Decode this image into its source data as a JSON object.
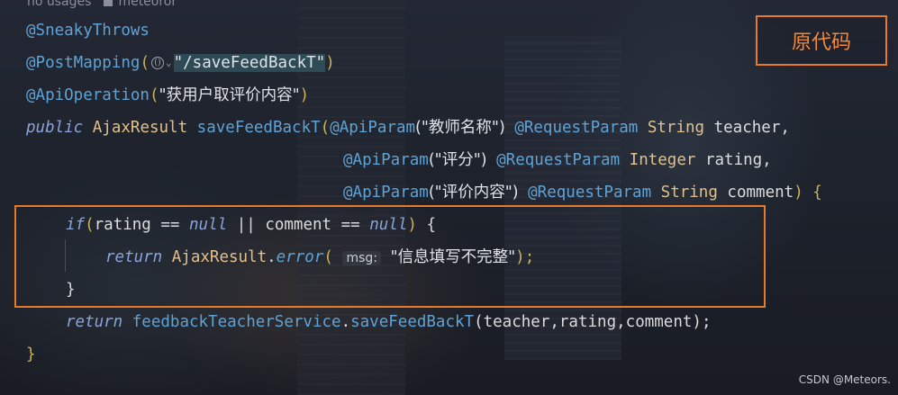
{
  "hint": {
    "usages": "no usages",
    "author": "meteoror"
  },
  "code": {
    "l1_annotation": "@SneakyThrows",
    "l2_annotation": "@PostMapping",
    "l2_open": "(",
    "l2_path": "\"/saveFeedBackT\"",
    "l2_close": ")",
    "l3_annotation": "@ApiOperation",
    "l3_open": "(",
    "l3_string": "\"获用户取评价内容\"",
    "l3_close": ")",
    "l4_public": "public",
    "l4_type": "AjaxResult",
    "l4_method": "saveFeedBackT",
    "l4_open": "(",
    "l4_ann": "@ApiParam",
    "l4_str": "(\"教师名称\")",
    "l4_ann2": "@RequestParam",
    "l4_ptype": "String",
    "l4_param": "teacher,",
    "l5_ann": "@ApiParam",
    "l5_str": "(\"评分\")",
    "l5_ann2": "@RequestParam",
    "l5_ptype": "Integer",
    "l5_param": "rating,",
    "l6_ann": "@ApiParam",
    "l6_str": "(\"评价内容\")",
    "l6_ann2": "@RequestParam",
    "l6_ptype": "String",
    "l6_param": "comment",
    "l6_close": ") {",
    "l7_if": "if",
    "l7_open": "(",
    "l7_a": "rating",
    "l7_eq": " == ",
    "l7_null": "null",
    "l7_or": " || ",
    "l7_b": "comment",
    "l7_eq2": " == ",
    "l7_null2": "null",
    "l7_close": ")",
    "l7_brace": " {",
    "l8_return": "return",
    "l8_type": "AjaxResult",
    "l8_dot": ".",
    "l8_method": "error",
    "l8_open": "(",
    "l8_hint": "msg:",
    "l8_str": "\"信息填写不完整\"",
    "l8_close": ");",
    "l9_brace": "}",
    "l10_return": "return",
    "l10_service": "feedbackTeacherService",
    "l10_dot": ".",
    "l10_method": "saveFeedBackT",
    "l10_args": "(teacher,rating,comment);",
    "l11_brace": "}"
  },
  "annotation_label": "原代码",
  "watermark": "CSDN @Meteors.",
  "colors": {
    "annotation": "#5fa3d6",
    "keyword": "#8aa3d8",
    "type": "#e2c08d",
    "highlight_box": "#e8782a"
  }
}
